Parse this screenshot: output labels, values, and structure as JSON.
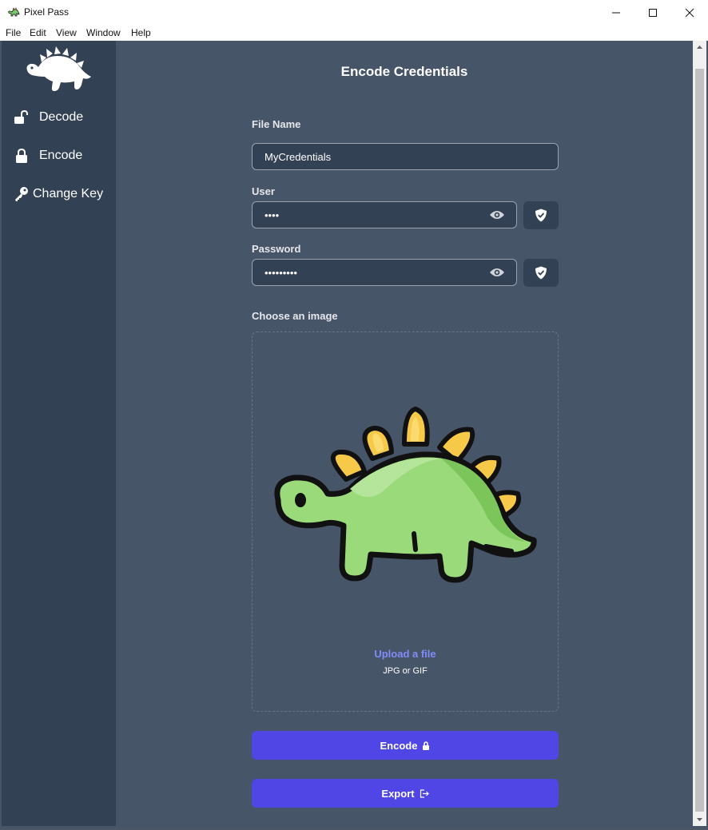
{
  "window": {
    "title": "Pixel Pass",
    "controls": [
      "minimize-icon",
      "maximize-icon",
      "close-icon"
    ]
  },
  "menu": [
    "File",
    "Edit",
    "View",
    "Window",
    "Help"
  ],
  "sidebar": {
    "items": [
      {
        "label": "Decode",
        "icon": "unlock-icon"
      },
      {
        "label": "Encode",
        "icon": "lock-icon"
      },
      {
        "label": "Change Key",
        "icon": "key-icon"
      }
    ]
  },
  "main": {
    "title": "Encode Credentials",
    "file_name": {
      "label": "File Name",
      "value": "MyCredentials"
    },
    "user": {
      "label": "User",
      "value": "••••"
    },
    "password": {
      "label": "Password",
      "value": "•••••••••"
    },
    "image": {
      "label": "Choose an image",
      "upload_link": "Upload a file",
      "hint": "JPG or GIF"
    },
    "encode_button": "Encode",
    "export_button": "Export"
  },
  "colors": {
    "sidebar_bg": "#334155",
    "main_bg": "#475569",
    "accent": "#4f46e5",
    "link": "#818cf8"
  }
}
